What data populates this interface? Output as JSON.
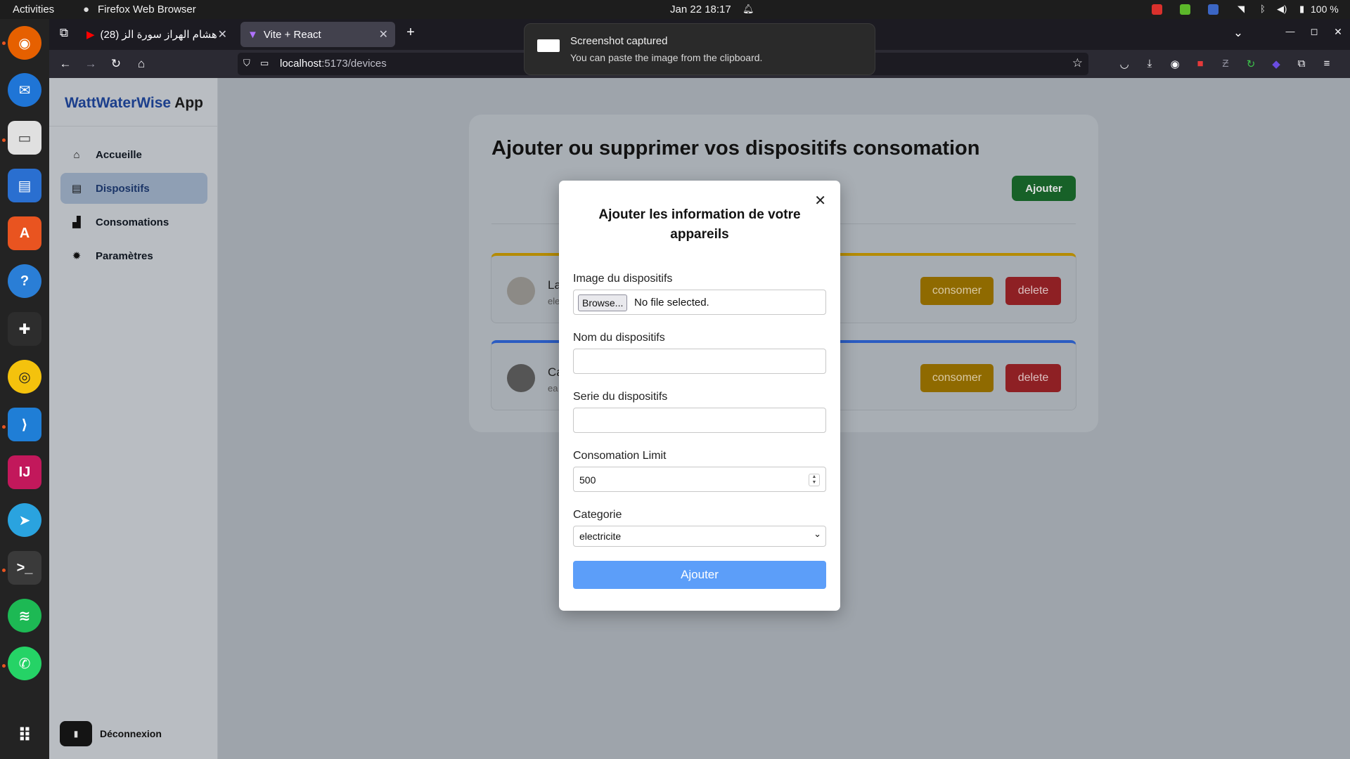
{
  "system": {
    "activities": "Activities",
    "app_name": "Firefox Web Browser",
    "datetime": "Jan 22  18:17",
    "battery": "100 %"
  },
  "notification": {
    "title": "Screenshot captured",
    "body": "You can paste the image from the clipboard."
  },
  "browser": {
    "tabs": [
      {
        "label": "(28) هشام الهراز سورة الز"
      },
      {
        "label": "Vite + React"
      }
    ],
    "url_host": "localhost",
    "url_path": ":5173/devices"
  },
  "sidebar": {
    "brand_main": "WattWaterWise",
    "brand_suffix": " App",
    "items": [
      {
        "label": "Accueille",
        "icon": "home-icon"
      },
      {
        "label": "Dispositifs",
        "icon": "device-icon"
      },
      {
        "label": "Consomations",
        "icon": "chart-icon"
      },
      {
        "label": "Paramètres",
        "icon": "gear-icon"
      }
    ],
    "logout": "Déconnexion"
  },
  "main": {
    "title": "Ajouter ou supprimer vos dispositifs consomation",
    "add_button": "Ajouter",
    "devices": [
      {
        "name_visible": "La",
        "category_visible": "ele",
        "accent": "#b58b00",
        "consume": "consomer",
        "delete": "delete"
      },
      {
        "name_visible": "Ca",
        "category_visible": "ea",
        "accent": "#2b5cc2",
        "consume": "consomer",
        "delete": "delete"
      }
    ]
  },
  "modal": {
    "title": "Ajouter les information de votre appareils",
    "image_label": "Image du dispositifs",
    "browse_label": "Browse...",
    "no_file": "No file selected.",
    "name_label": "Nom du dispositifs",
    "name_value": "",
    "serie_label": "Serie du dispositifs",
    "serie_value": "",
    "limit_label": "Consomation Limit",
    "limit_value": "500",
    "category_label": "Categorie",
    "category_value": "electricite",
    "submit_label": "Ajouter"
  },
  "colors": {
    "primary_blue": "#5c9ef9",
    "success_green": "#176128",
    "warning_yellow": "#8f6a00",
    "danger_red": "#8e2024"
  }
}
